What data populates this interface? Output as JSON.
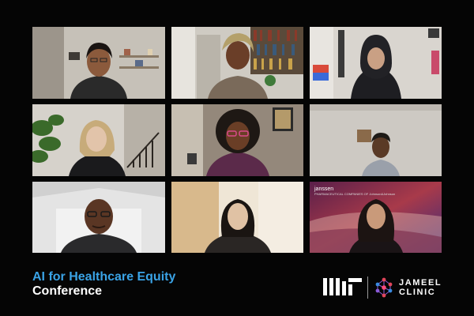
{
  "conference": {
    "title_line1": "AI for Healthcare Equity",
    "title_line2": "Conference"
  },
  "logos": {
    "mit": "MIT",
    "jameel_line1": "JAMEEL",
    "jameel_line2": "CLINIC"
  },
  "tiles": [
    {
      "id": "participant-1",
      "background": "#bfbab1"
    },
    {
      "id": "participant-2",
      "background": "#c7c3bb"
    },
    {
      "id": "participant-3",
      "background": "#d6d2cc"
    },
    {
      "id": "participant-4",
      "background": "#cfcac3"
    },
    {
      "id": "participant-5",
      "background": "#8a7f74"
    },
    {
      "id": "participant-6",
      "background": "#c9c5bf"
    },
    {
      "id": "participant-7",
      "background": "#e3e3e3"
    },
    {
      "id": "participant-8",
      "background": "#ebe3d4"
    },
    {
      "id": "participant-9",
      "background": "#6b1f3a",
      "watermark": "janssen",
      "watermark_sub": "PHARMACEUTICAL COMPANIES OF Johnson&Johnson"
    }
  ],
  "colors": {
    "accent": "#3aa3e6",
    "background": "#050505"
  }
}
